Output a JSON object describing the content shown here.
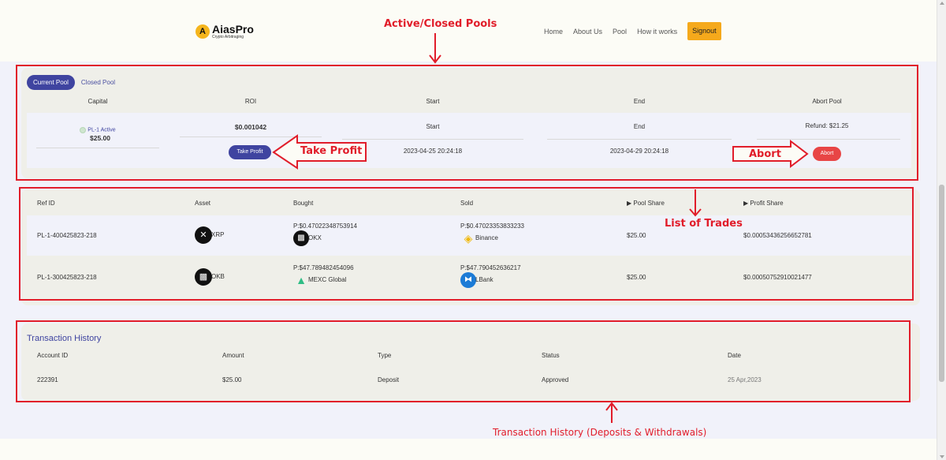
{
  "brand": {
    "name": "AiasPro",
    "tagline": "Crypto Arbitraging"
  },
  "nav": {
    "items": [
      "Home",
      "About Us",
      "Pool",
      "How it works"
    ],
    "signout": "Signout"
  },
  "pool_tabs": {
    "current": "Current Pool",
    "closed": "Closed Pool"
  },
  "pool_table": {
    "headers": [
      "Capital",
      "ROI",
      "Start",
      "End",
      "Abort Pool"
    ],
    "row": {
      "status": "PL-1 Active",
      "capital": "$25.00",
      "roi": "$0.001042",
      "start_label": "Start",
      "end_label": "End",
      "refund": "Refund: $21.25",
      "take_profit": "Take Profit",
      "start_date": "2023-04-25 20:24:18",
      "end_date": "2023-04-29 20:24:18",
      "abort": "Abort"
    }
  },
  "trades": {
    "headers": {
      "ref": "Ref ID",
      "asset": "Asset",
      "bought": "Bought",
      "sold": "Sold",
      "pool_share": "▶ Pool Share",
      "profit_share": "▶ Profit Share"
    },
    "rows": [
      {
        "ref": "PL-1-400425823-218",
        "asset": "XRP",
        "bought_price": "P:$0.47022348753914",
        "bought_exchange": "OKX",
        "sold_price": "P:$0.47023353833233",
        "sold_exchange": "Binance",
        "pool_share": "$25.00",
        "profit_share": "$0.00053436256652781"
      },
      {
        "ref": "PL-1-300425823-218",
        "asset": "OKB",
        "bought_price": "P:$47.789482454096",
        "bought_exchange": "MEXC Global",
        "sold_price": "P:$47.790452636217",
        "sold_exchange": "LBank",
        "pool_share": "$25.00",
        "profit_share": "$0.00050752910021477"
      }
    ]
  },
  "transactions": {
    "title": "Transaction History",
    "headers": [
      "Account ID",
      "Amount",
      "Type",
      "Status",
      "Date"
    ],
    "rows": [
      {
        "account_id": "222391",
        "amount": "$25.00",
        "type": "Deposit",
        "status": "Approved",
        "date": "25 Apr,2023"
      }
    ]
  },
  "annotations": {
    "pools": "Active/Closed Pools",
    "take_profit": "Take Profit",
    "abort": "Abort",
    "trades": "List of Trades",
    "history": "Transaction History (Deposits & Withdrawals)"
  },
  "icons": {
    "logo": "aiaspro-logo-icon",
    "xrp": "xrp-icon",
    "okx": "okx-icon",
    "binance": "binance-icon",
    "mexc": "mexc-icon",
    "lbank": "lbank-icon",
    "okb": "okb-icon"
  },
  "colors": {
    "primary": "#3f44a0",
    "accent": "#f5a91b",
    "danger": "#e84545",
    "annotation": "#e11d2a"
  }
}
